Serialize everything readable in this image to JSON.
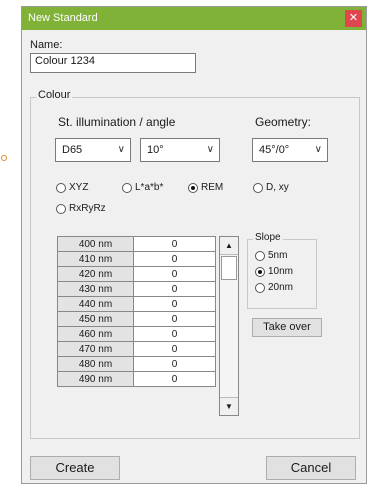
{
  "window": {
    "title": "New Standard",
    "close_icon": "close-icon"
  },
  "name_field": {
    "label": "Name:",
    "value": "Colour 1234"
  },
  "colour_group": {
    "title": "Colour",
    "illumination": {
      "label": "St. illumination / angle",
      "illuminant": "D65",
      "angle": "10°"
    },
    "geometry": {
      "label": "Geometry:",
      "value": "45°/0°"
    },
    "color_spaces": [
      {
        "label": "XYZ",
        "selected": false
      },
      {
        "label": "L*a*b*",
        "selected": false
      },
      {
        "label": "REM",
        "selected": true
      },
      {
        "label": "D, xy",
        "selected": false
      },
      {
        "label": "RxRyRz",
        "selected": false
      }
    ],
    "table_rows": [
      {
        "wavelength": "400 nm",
        "value": "0"
      },
      {
        "wavelength": "410 nm",
        "value": "0"
      },
      {
        "wavelength": "420 nm",
        "value": "0"
      },
      {
        "wavelength": "430 nm",
        "value": "0"
      },
      {
        "wavelength": "440 nm",
        "value": "0"
      },
      {
        "wavelength": "450 nm",
        "value": "0"
      },
      {
        "wavelength": "460 nm",
        "value": "0"
      },
      {
        "wavelength": "470 nm",
        "value": "0"
      },
      {
        "wavelength": "480 nm",
        "value": "0"
      },
      {
        "wavelength": "490 nm",
        "value": "0"
      }
    ],
    "slope": {
      "title": "Slope",
      "options": [
        {
          "label": "5nm",
          "selected": false
        },
        {
          "label": "10nm",
          "selected": true
        },
        {
          "label": "20nm",
          "selected": false
        }
      ]
    },
    "take_over_label": "Take over"
  },
  "buttons": {
    "create": "Create",
    "cancel": "Cancel"
  },
  "colors": {
    "titlebar": "#7fb237",
    "close": "#e0464e",
    "accent": "#e08a2a"
  }
}
